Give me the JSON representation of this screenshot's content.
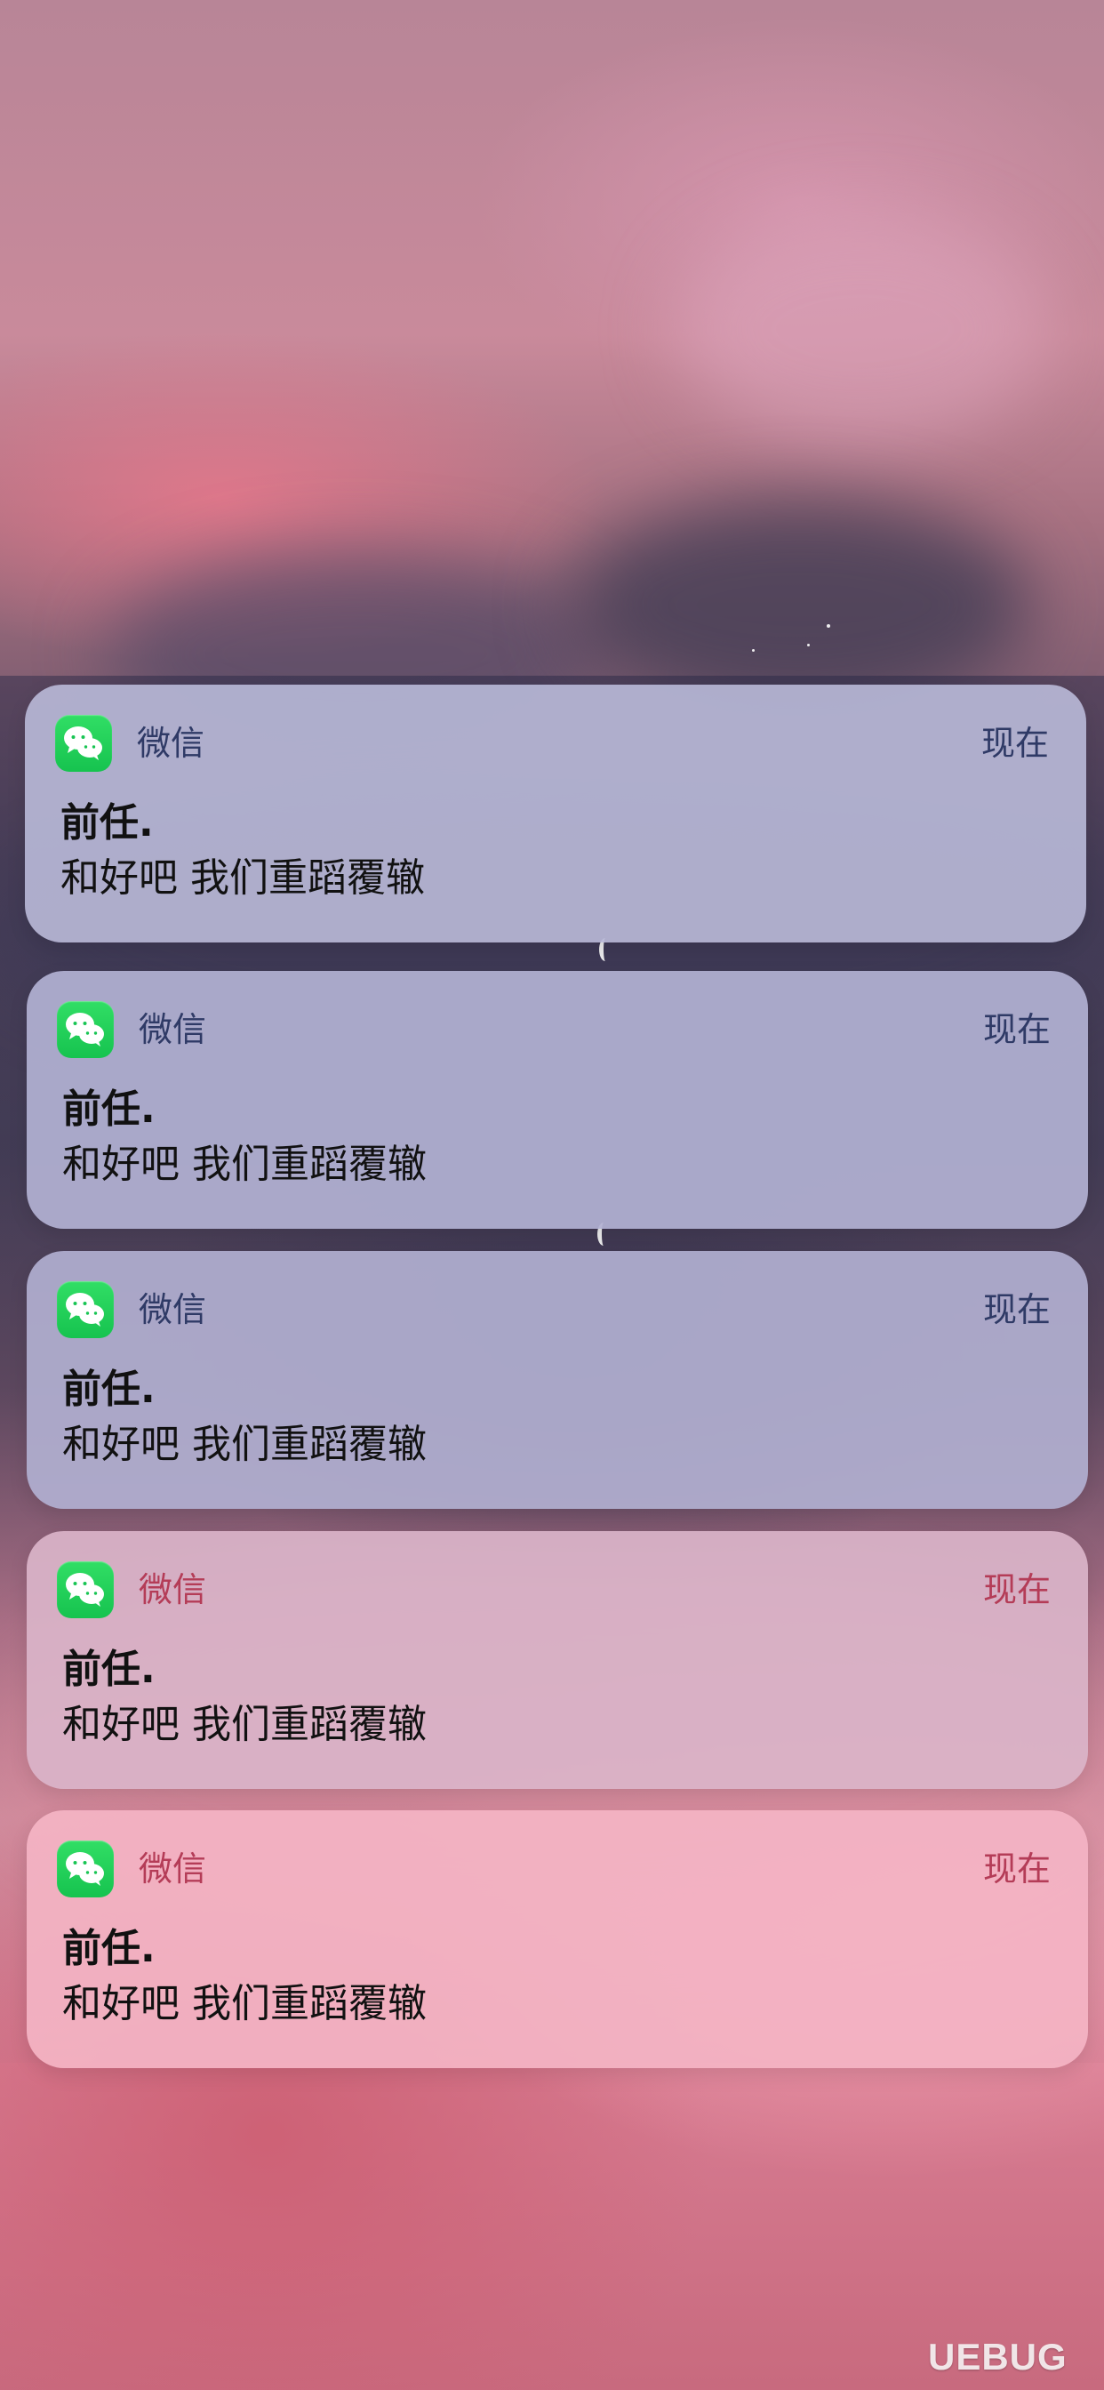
{
  "notifications": [
    {
      "app_name": "微信",
      "time": "现在",
      "title": "前任.",
      "body": "和好吧 我们重蹈覆辙",
      "app_icon": "wechat-icon"
    },
    {
      "app_name": "微信",
      "time": "现在",
      "title": "前任.",
      "body": "和好吧 我们重蹈覆辙",
      "app_icon": "wechat-icon"
    },
    {
      "app_name": "微信",
      "time": "现在",
      "title": "前任.",
      "body": "和好吧 我们重蹈覆辙",
      "app_icon": "wechat-icon"
    },
    {
      "app_name": "微信",
      "time": "现在",
      "title": "前任.",
      "body": "和好吧 我们重蹈覆辙",
      "app_icon": "wechat-icon"
    },
    {
      "app_name": "微信",
      "time": "现在",
      "title": "前任.",
      "body": "和好吧 我们重蹈覆辙",
      "app_icon": "wechat-icon"
    }
  ],
  "watermark": {
    "text": "UEBUG"
  },
  "colors": {
    "wechat_green": "#18c553",
    "header_text_blue": "#2f3a66",
    "header_text_pink": "#b43c57",
    "body_text": "#111111"
  }
}
